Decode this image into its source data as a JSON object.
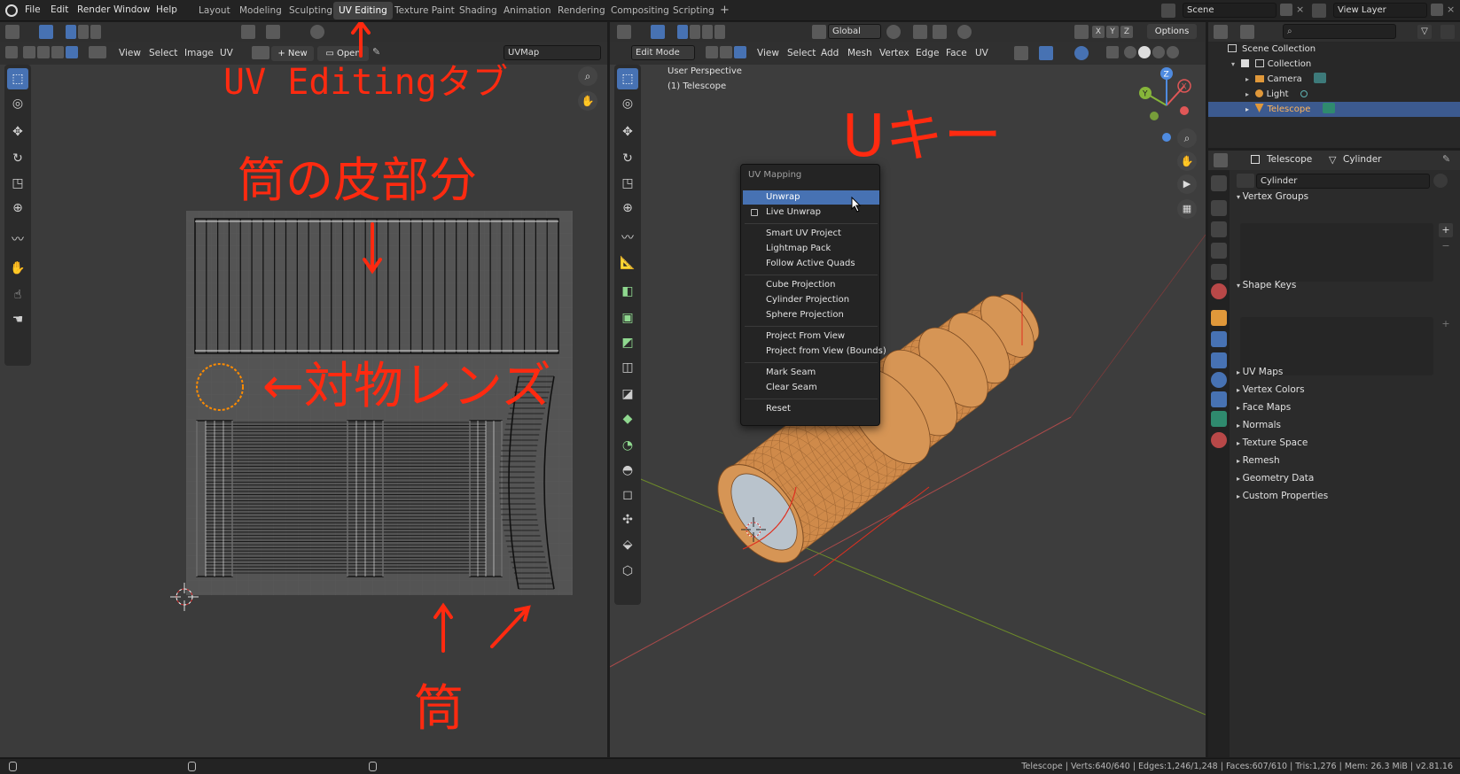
{
  "topbar": {
    "menus": [
      "File",
      "Edit",
      "Render",
      "Window",
      "Help"
    ],
    "workspaces": [
      "Layout",
      "Modeling",
      "Sculpting",
      "UV Editing",
      "Texture Paint",
      "Shading",
      "Animation",
      "Rendering",
      "Compositing",
      "Scripting"
    ],
    "active_workspace": "UV Editing",
    "add_tab": "+",
    "scene": "Scene",
    "view_layer": "View Layer"
  },
  "uv_editor": {
    "menus": [
      "View",
      "Select",
      "Image",
      "UV"
    ],
    "new_label": "New",
    "open_label": "Open",
    "uvmap": "UVMap"
  },
  "viewport": {
    "mode": "Edit Mode",
    "menus": [
      "View",
      "Select",
      "Add",
      "Mesh",
      "Vertex",
      "Edge",
      "Face",
      "UV"
    ],
    "transform_orientation": "Global",
    "options_label": "Options",
    "axis_x": "X",
    "axis_y": "Y",
    "axis_z": "Z",
    "perspective": "User Perspective",
    "object_label": "(1) Telescope"
  },
  "uv_menu": {
    "title": "UV Mapping",
    "items": [
      {
        "label": "Unwrap",
        "active": true
      },
      {
        "label": "Live Unwrap",
        "checkbox": true
      },
      {
        "label": "Smart UV Project"
      },
      {
        "label": "Lightmap Pack"
      },
      {
        "label": "Follow Active Quads"
      },
      {
        "label": "Cube Projection"
      },
      {
        "label": "Cylinder Projection"
      },
      {
        "label": "Sphere Projection"
      },
      {
        "label": "Project From View"
      },
      {
        "label": "Project from View (Bounds)"
      },
      {
        "label": "Mark Seam"
      },
      {
        "label": "Clear Seam"
      },
      {
        "label": "Reset"
      }
    ]
  },
  "outliner": {
    "rows": [
      "Scene Collection",
      "Collection",
      "Camera",
      "Light",
      "Telescope"
    ],
    "selected": "Telescope"
  },
  "properties": {
    "breadcrumb_object": "Telescope",
    "breadcrumb_data": "Cylinder",
    "mesh_name": "Cylinder",
    "sections": [
      "Vertex Groups",
      "Shape Keys",
      "UV Maps",
      "Vertex Colors",
      "Face Maps",
      "Normals",
      "Texture Space",
      "Remesh",
      "Geometry Data",
      "Custom Properties"
    ]
  },
  "annotations": {
    "uv_editing_tab": "UV Editingタブ",
    "tube_skin": "筒の皮部分",
    "objective_lens": "←対物レンズ",
    "tube": "筒",
    "u_key": "Uキー"
  },
  "status": {
    "stats": "Telescope | Verts:640/640 | Edges:1,246/1,248 | Faces:607/610 | Tris:1,276 | Mem: 26.3 MiB | v2.81.16"
  },
  "colors": {
    "accent": "#4772b3",
    "annotation": "#ff2a10",
    "mesh_orange": "#d9924e",
    "selection_orange": "#ff8c00"
  }
}
